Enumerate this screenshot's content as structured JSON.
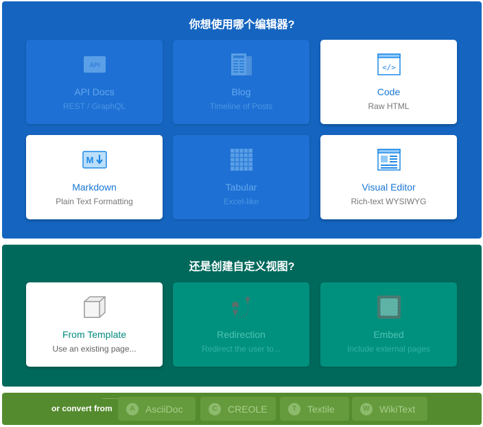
{
  "editors": {
    "heading": "你想使用哪个编辑器?",
    "cards": [
      {
        "title": "API Docs",
        "subtitle": "REST / GraphQL",
        "icon": "api-icon",
        "state": "disabled"
      },
      {
        "title": "Blog",
        "subtitle": "Timeline of Posts",
        "icon": "blog-icon",
        "state": "disabled"
      },
      {
        "title": "Code",
        "subtitle": "Raw HTML",
        "icon": "code-icon",
        "state": "enabled"
      },
      {
        "title": "Markdown",
        "subtitle": "Plain Text Formatting",
        "icon": "markdown-icon",
        "state": "enabled"
      },
      {
        "title": "Tabular",
        "subtitle": "Excel-like",
        "icon": "table-icon",
        "state": "disabled"
      },
      {
        "title": "Visual Editor",
        "subtitle": "Rich-text WYSIWYG",
        "icon": "visual-editor-icon",
        "state": "enabled"
      }
    ]
  },
  "custom": {
    "heading": "还是创建自定义视图?",
    "cards": [
      {
        "title": "From Template",
        "subtitle": "Use an existing page...",
        "icon": "cube-icon",
        "state": "enabled"
      },
      {
        "title": "Redirection",
        "subtitle": "Redirect the user to...",
        "icon": "redirect-icon",
        "state": "disabled"
      },
      {
        "title": "Embed",
        "subtitle": "Include external pages",
        "icon": "embed-icon",
        "state": "disabled"
      }
    ]
  },
  "convert": {
    "label": "or convert from",
    "options": [
      {
        "badge": "A",
        "label": "AsciiDoc"
      },
      {
        "badge": "C",
        "label": "CREOLE"
      },
      {
        "badge": "T",
        "label": "Textile"
      },
      {
        "badge": "W",
        "label": "WikiText"
      }
    ]
  },
  "colors": {
    "editors_panel": "#1565c0",
    "custom_panel": "#00695c",
    "convert_panel": "#558b2f"
  }
}
